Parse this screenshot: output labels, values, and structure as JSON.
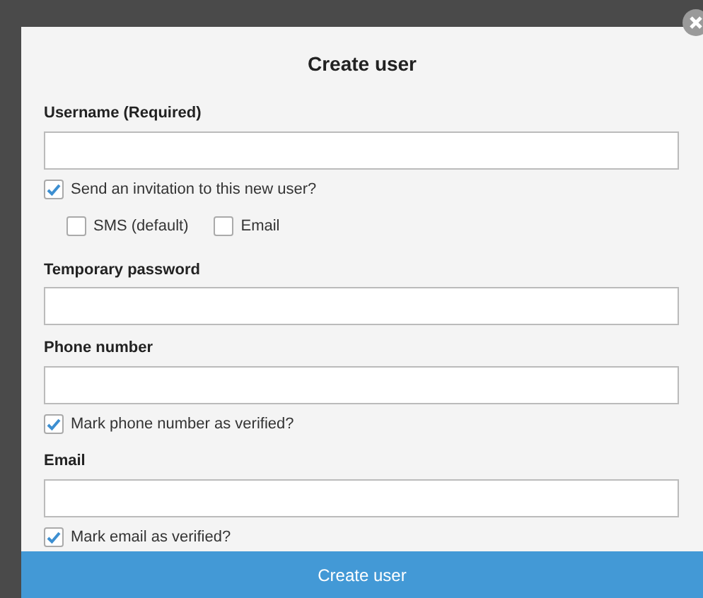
{
  "dialog": {
    "title": "Create user",
    "items": [
      {
        "kind": "field",
        "label": "Username (Required)"
      },
      {
        "kind": "checkbox",
        "label": "Send an invitation to this new user?",
        "checked": true
      },
      {
        "kind": "options",
        "options": [
          {
            "label": "SMS (default)",
            "checked": false
          },
          {
            "label": "Email",
            "checked": false
          }
        ]
      },
      {
        "kind": "field",
        "label": "Temporary password"
      },
      {
        "kind": "field",
        "label": "Phone number"
      },
      {
        "kind": "checkbox",
        "label": "Mark phone number as verified?",
        "checked": true
      },
      {
        "kind": "field",
        "label": "Email"
      },
      {
        "kind": "checkbox",
        "label": "Mark email as verified?",
        "checked": true
      }
    ],
    "submit": "Create user"
  }
}
